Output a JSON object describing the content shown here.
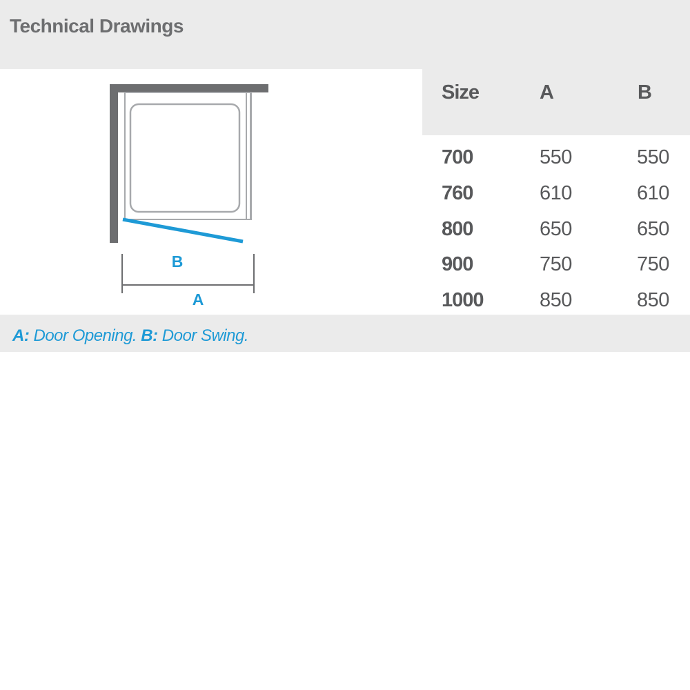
{
  "header": {
    "title": "Technical Drawings"
  },
  "drawing": {
    "label_b": "B",
    "label_a": "A",
    "colors": {
      "wall": "#6d6e70",
      "frame": "#a7a9ac",
      "door": "#1e9ad6"
    }
  },
  "table": {
    "columns": [
      "Size",
      "A",
      "B"
    ],
    "rows": [
      [
        "700",
        "550",
        "550"
      ],
      [
        "760",
        "610",
        "610"
      ],
      [
        "800",
        "650",
        "650"
      ],
      [
        "900",
        "750",
        "750"
      ],
      [
        "1000",
        "850",
        "850"
      ]
    ]
  },
  "legend": {
    "a_key": "A:",
    "a_text": "Door Opening.",
    "b_key": "B:",
    "b_text": "Door Swing."
  }
}
